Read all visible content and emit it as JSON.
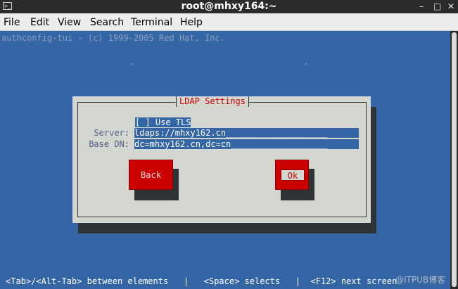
{
  "window": {
    "title": "root@mhxy164:~",
    "icon": "terminal-icon",
    "controls": [
      "minimize-icon",
      "maximize-icon",
      "close-icon"
    ]
  },
  "menu": {
    "items": [
      "File",
      "Edit",
      "View",
      "Search",
      "Terminal",
      "Help"
    ]
  },
  "terminal": {
    "header": "authconfig-tui - (c) 1999-2005 Red Hat, Inc.",
    "dialog": {
      "title": "LDAP Settings",
      "use_tls": "[ ] Use TLS",
      "server_label": "Server:",
      "server_value": "ldaps://mhxy162.cn____________________",
      "basedn_label": "Base DN:",
      "basedn_value": "dc=mhxy162.cn,dc=cn___________________",
      "back_label": "Back",
      "ok_label": "Ok"
    },
    "status": "<Tab>/<Alt-Tab> between elements   |   <Space> selects   |  <F12> next screen",
    "watermark": "@ITPUB博客"
  },
  "colors": {
    "terminal_bg": "#3465a4",
    "dialog_bg": "#d3d7cf",
    "button_red": "#cc0000",
    "shadow": "#2e3436"
  }
}
